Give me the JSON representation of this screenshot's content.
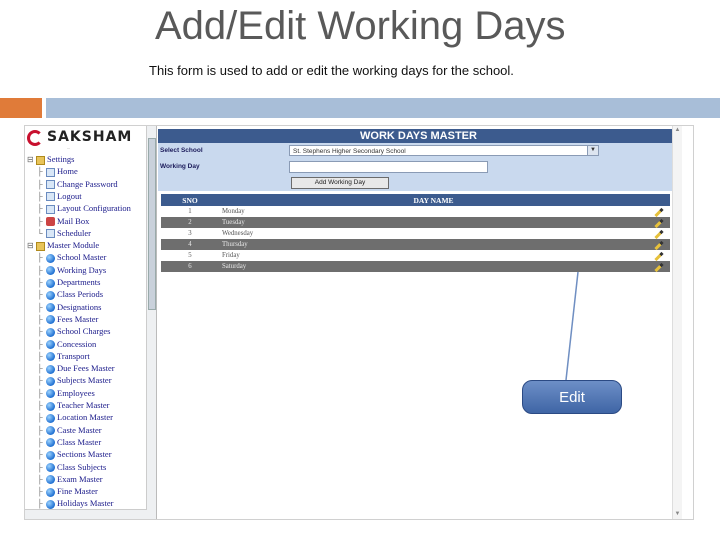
{
  "slide": {
    "title": "Add/Edit Working Days",
    "subtitle": "This form is used to add or edit the working days for the school."
  },
  "logo": {
    "word": "SAKSHAM",
    "tagline": "..."
  },
  "tree": {
    "items": [
      {
        "label": "Settings",
        "icon": "folder-icon"
      },
      {
        "label": "Home",
        "icon": "page-icon"
      },
      {
        "label": "Change Password",
        "icon": "page-icon"
      },
      {
        "label": "Logout",
        "icon": "page-icon"
      },
      {
        "label": "Layout Configuration",
        "icon": "page-icon"
      },
      {
        "label": "Mail Box",
        "icon": "mail-icon"
      },
      {
        "label": "Scheduler",
        "icon": "page-icon"
      },
      {
        "label": "Master Module",
        "icon": "folder-icon"
      },
      {
        "label": "School Master",
        "icon": "dot-icon"
      },
      {
        "label": "Working Days",
        "icon": "dot-icon"
      },
      {
        "label": "Departments",
        "icon": "dot-icon"
      },
      {
        "label": "Class Periods",
        "icon": "dot-icon"
      },
      {
        "label": "Designations",
        "icon": "dot-icon"
      },
      {
        "label": "Fees Master",
        "icon": "dot-icon"
      },
      {
        "label": "School Charges",
        "icon": "dot-icon"
      },
      {
        "label": "Concession",
        "icon": "dot-icon"
      },
      {
        "label": "Transport",
        "icon": "dot-icon"
      },
      {
        "label": "Due Fees Master",
        "icon": "dot-icon"
      },
      {
        "label": "Subjects Master",
        "icon": "dot-icon"
      },
      {
        "label": "Employees",
        "icon": "dot-icon"
      },
      {
        "label": "Teacher Master",
        "icon": "dot-icon"
      },
      {
        "label": "Location Master",
        "icon": "dot-icon"
      },
      {
        "label": "Caste Master",
        "icon": "dot-icon"
      },
      {
        "label": "Class Master",
        "icon": "dot-icon"
      },
      {
        "label": "Sections Master",
        "icon": "dot-icon"
      },
      {
        "label": "Class Subjects",
        "icon": "dot-icon"
      },
      {
        "label": "Exam Master",
        "icon": "dot-icon"
      },
      {
        "label": "Fine Master",
        "icon": "dot-icon"
      },
      {
        "label": "Holidays Master",
        "icon": "dot-icon"
      }
    ]
  },
  "form": {
    "header": "WORK DAYS MASTER",
    "select_school_label": "Select School",
    "select_school_value": "St. Stephens Higher Secondary School",
    "working_day_label": "Working Day",
    "working_day_value": "",
    "add_button": "Add Working Day"
  },
  "table": {
    "headers": [
      "SNO",
      "DAY NAME"
    ],
    "rows": [
      {
        "sno": "1",
        "day": "Monday"
      },
      {
        "sno": "2",
        "day": "Tuesday"
      },
      {
        "sno": "3",
        "day": "Wednesday"
      },
      {
        "sno": "4",
        "day": "Thursday"
      },
      {
        "sno": "5",
        "day": "Friday"
      },
      {
        "sno": "6",
        "day": "Saturday"
      }
    ]
  },
  "callout": {
    "label": "Edit"
  },
  "colors": {
    "accent_orange": "#e07b39",
    "accent_blue": "#a8bed8",
    "header_navy": "#3c5b8e",
    "form_bg": "#c9d9ee"
  }
}
